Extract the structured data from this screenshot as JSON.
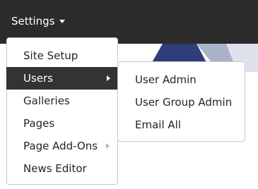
{
  "navbar": {
    "settings_label": "Settings",
    "caret_icon": "caret-down-icon"
  },
  "menu": {
    "items": [
      {
        "label": "Site Setup",
        "has_submenu": false,
        "active": false
      },
      {
        "label": "Users",
        "has_submenu": true,
        "active": true
      },
      {
        "label": "Galleries",
        "has_submenu": false,
        "active": false
      },
      {
        "label": "Pages",
        "has_submenu": false,
        "active": false
      },
      {
        "label": "Page Add-Ons",
        "has_submenu": true,
        "active": false
      },
      {
        "label": "News Editor",
        "has_submenu": false,
        "active": false
      }
    ]
  },
  "submenu": {
    "items": [
      {
        "label": "User Admin"
      },
      {
        "label": "User Group Admin"
      },
      {
        "label": "Email All"
      }
    ]
  },
  "colors": {
    "navbar_bg": "#2b2b2b",
    "active_bg": "#333333",
    "text": "#212529",
    "border": "#c8c8c8"
  }
}
